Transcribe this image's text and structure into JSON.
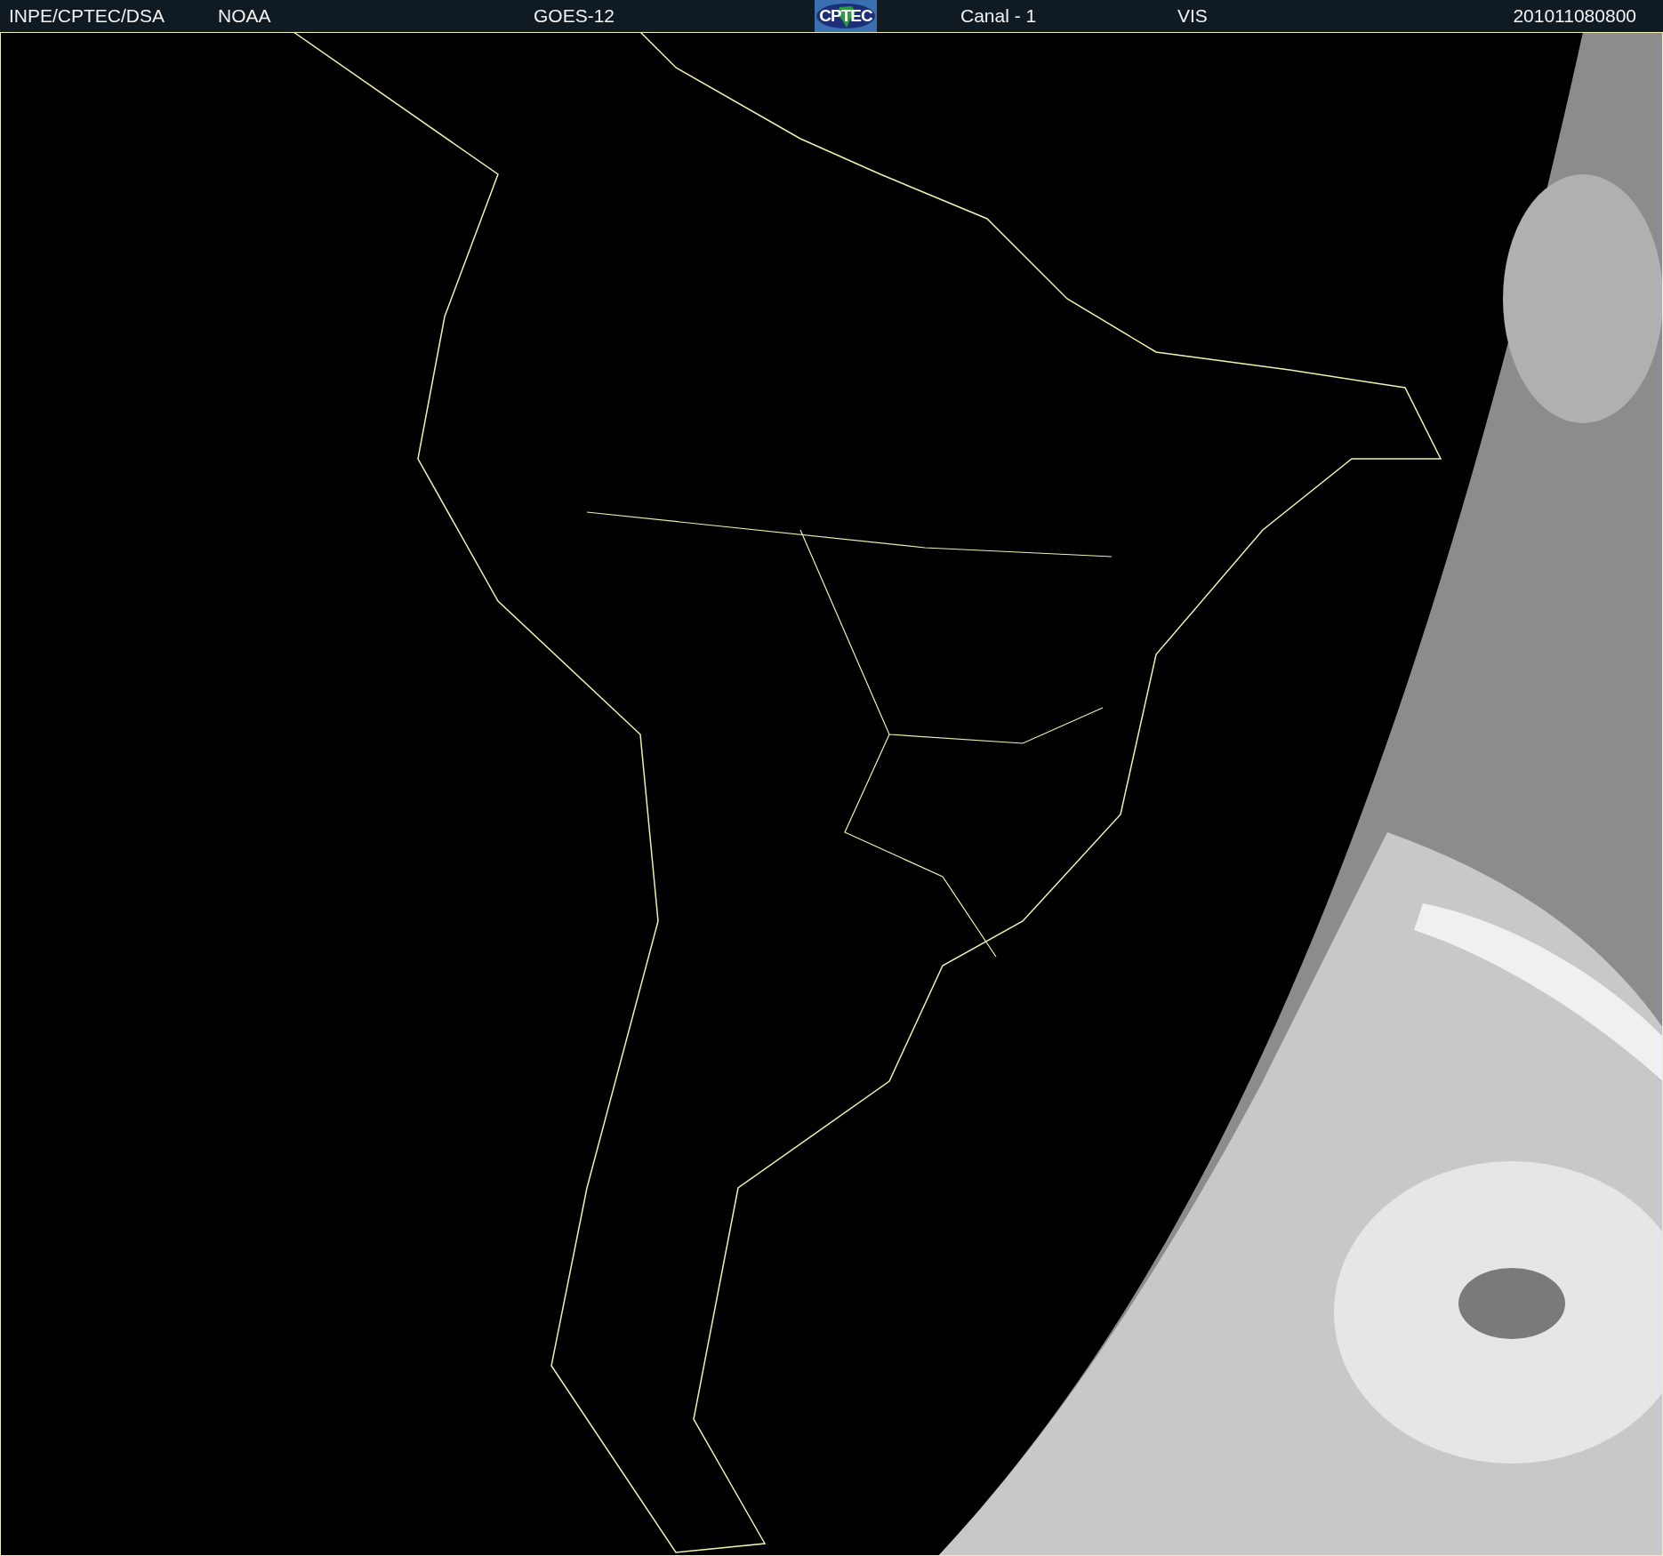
{
  "header": {
    "source": "INPE/CPTEC/DSA",
    "agency": "NOAA",
    "satellite": "GOES-12",
    "logo_text": "CPTEC",
    "channel": "Canal - 1",
    "band": "VIS",
    "timestamp": "201011080800"
  }
}
